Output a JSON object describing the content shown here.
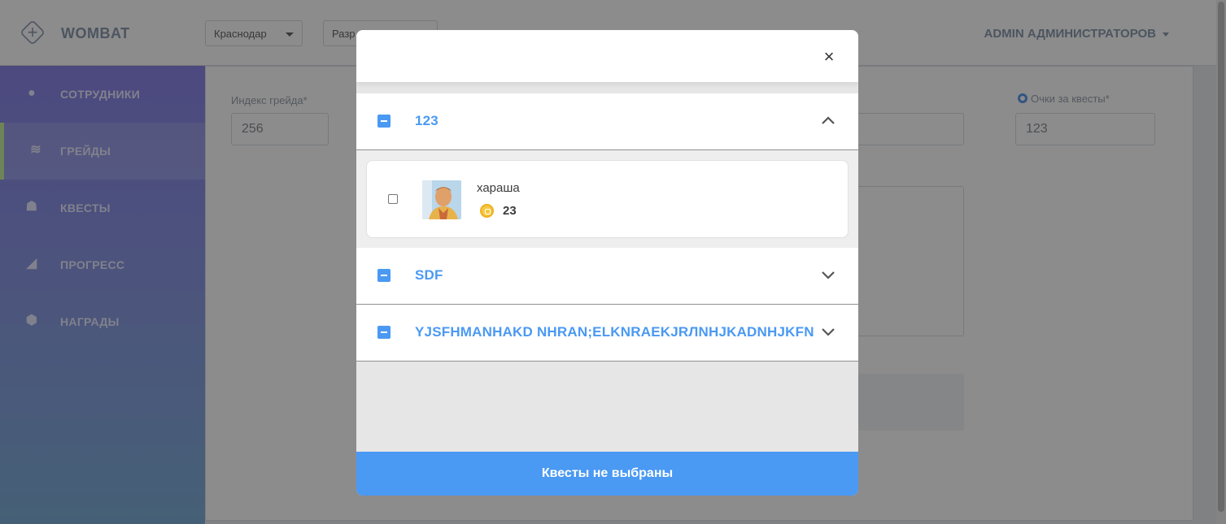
{
  "app": {
    "brand": "WOMBAT",
    "city_select": "Краснодар",
    "dept_select": "Разр",
    "user": "ADMIN АДМИНИСТРАТОРОВ"
  },
  "sidebar": {
    "items": [
      {
        "label": "СОТРУДНИКИ",
        "icon": "user-icon"
      },
      {
        "label": "ГРЕЙДЫ",
        "icon": "layers-icon",
        "active": true
      },
      {
        "label": "КВЕСТЫ",
        "icon": "quest-icon"
      },
      {
        "label": "ПРОГРЕСС",
        "icon": "progress-icon"
      },
      {
        "label": "НАГРАДЫ",
        "icon": "badge-icon"
      }
    ]
  },
  "form": {
    "grade_index_label": "Индекс грейда*",
    "grade_index_value": "256",
    "quest_points_label": "Очки за квесты*",
    "quest_points_value": "123"
  },
  "modal": {
    "groups": [
      {
        "title": "123",
        "expanded": true
      },
      {
        "title": "SDF",
        "expanded": false
      },
      {
        "title": "YJSFHMANHAKD NHRAN;ELKNRAEKJRЛNHJKADNHJKFN",
        "expanded": false
      }
    ],
    "quest": {
      "name": "хараша",
      "points": "23"
    },
    "footer_label": "Квесты не выбраны"
  },
  "colors": {
    "accent": "#4a99f3",
    "sidebar_top": "#8b86e8",
    "sidebar_bottom": "#7fb0d8"
  }
}
